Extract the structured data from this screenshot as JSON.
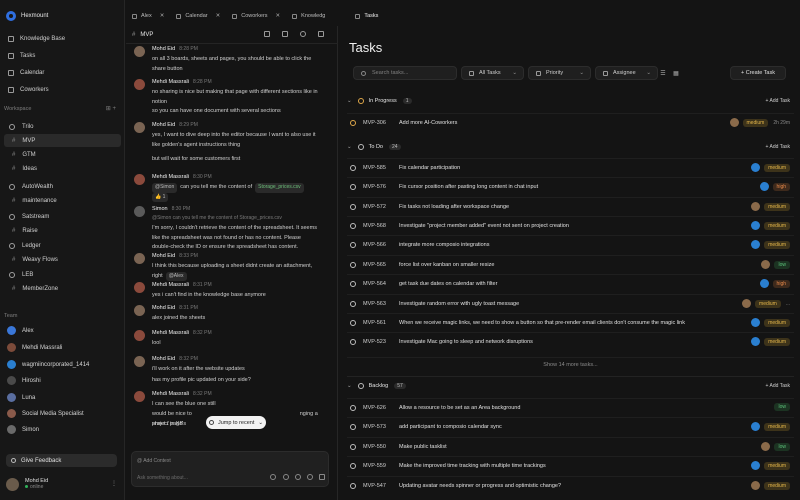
{
  "workspace": {
    "name": "Hexmount"
  },
  "nav": [
    {
      "label": "Knowledge Base",
      "icon": "book-icon"
    },
    {
      "label": "Tasks",
      "icon": "checklist-icon"
    },
    {
      "label": "Calendar",
      "icon": "calendar-icon"
    },
    {
      "label": "Coworkers",
      "icon": "people-icon"
    }
  ],
  "workspace_section": {
    "label": "Workspace"
  },
  "workspace_items": [
    {
      "label": "Trilo",
      "type": "group"
    },
    {
      "label": "MVP",
      "type": "channel",
      "active": true
    },
    {
      "label": "GTM",
      "type": "channel"
    },
    {
      "label": "Ideas",
      "type": "channel"
    },
    {
      "label": "AutoWealth",
      "type": "group"
    },
    {
      "label": "maintenance",
      "type": "channel"
    },
    {
      "label": "Satstream",
      "type": "group"
    },
    {
      "label": "Raise",
      "type": "channel"
    },
    {
      "label": "Ledger",
      "type": "group"
    },
    {
      "label": "Weavy Flows",
      "type": "channel"
    },
    {
      "label": "LEB",
      "type": "group"
    },
    {
      "label": "MemberZone",
      "type": "channel"
    }
  ],
  "team_section": {
    "label": "Team"
  },
  "team": [
    {
      "name": "Alex",
      "color": "#3a77d8"
    },
    {
      "name": "Mehdi Massrali",
      "color": "#7c4b3a"
    },
    {
      "name": "wagmiincorporated_1414",
      "color": "#2a7fd0"
    },
    {
      "name": "Hiroshi",
      "color": "#4a4a4a"
    },
    {
      "name": "Luna",
      "color": "#5a6ea0"
    },
    {
      "name": "Social Media Specialist",
      "color": "#8a5a4a"
    },
    {
      "name": "Simon",
      "color": "#6a6a6a"
    }
  ],
  "feedback": {
    "label": "Give Feedback"
  },
  "user": {
    "name": "Mohd Eid",
    "status": "online"
  },
  "tabs": [
    {
      "label": "Alex",
      "active": false
    },
    {
      "label": "Calendar",
      "active": false
    },
    {
      "label": "Coworkers",
      "active": false
    },
    {
      "label": "Knowledg",
      "active": false
    },
    {
      "label": "Tasks",
      "active": true
    }
  ],
  "chat": {
    "channel": "MVP",
    "messages": [
      {
        "author": "Mohd Eid",
        "time": "8:28 PM",
        "lines": [
          "on all 3 boards, sheets and pages, you should be able to click the",
          "share button"
        ]
      },
      {
        "author": "Mehdi Massrali",
        "time": "8:28 PM",
        "lines": [
          "no sharing is nice but making that page with different sections like in",
          "notion"
        ]
      },
      {
        "author": "",
        "time": "",
        "lines": [
          "so you can have one document with several sections"
        ]
      },
      {
        "author": "Mohd Eid",
        "time": "8:29 PM",
        "lines": [
          "yes, I want to dive deep into the editor because I want to also use it",
          "like golden's agent instructions thing"
        ]
      },
      {
        "author": "",
        "time": "",
        "lines": [
          "but will wait for some customers first"
        ]
      },
      {
        "author": "Mehdi Massrali",
        "time": "8:30 PM",
        "lines": [
          "can you tell me the content of"
        ],
        "chip_user": "@Simon",
        "chip_file": "Storage_prices.csv",
        "reaction": "1"
      },
      {
        "author": "Simon",
        "time": "8:30 PM",
        "lines": [
          "I'm sorry, I couldn't retrieve the content of the spreadsheet. It seems",
          "like the spreadsheet was not found or has no content. Please",
          "double-check the ID or ensure the spreadsheet has content."
        ],
        "reply": "@Simon can you tell me the content of Storage_prices.csv"
      },
      {
        "author": "Mohd Eid",
        "time": "8:33 PM",
        "lines": [
          "I think this because uploading a sheet didnt create an attachment,",
          "right"
        ],
        "chip_user": "@Alex"
      },
      {
        "author": "Mehdi Massrali",
        "time": "8:31 PM",
        "lines": [
          "yes i can't find in the knowledge base anymore"
        ]
      },
      {
        "author": "Mohd Eid",
        "time": "8:31 PM",
        "lines": [
          "alex joined the sheets"
        ]
      },
      {
        "author": "Mehdi Massrali",
        "time": "8:32 PM",
        "lines": [
          "lool"
        ]
      },
      {
        "author": "Mohd Eid",
        "time": "8:32 PM",
        "lines": [
          "i'll work on it after the website updates"
        ]
      },
      {
        "author": "",
        "time": "",
        "lines": [
          "has my profile pic updated on your side?"
        ]
      },
      {
        "author": "Mehdi Massrali",
        "time": "8:32 PM",
        "lines": [
          "I can see the blue one still"
        ]
      },
      {
        "author": "",
        "time": "",
        "lines": [
          "would be nice to",
          "project in KB"
        ],
        "tail": "nging a sheet / page's"
      }
    ],
    "jump_label": "Jump to recent",
    "compose": {
      "context_label": "Add Context",
      "placeholder": "Ask something about..."
    }
  },
  "tasks": {
    "title": "Tasks",
    "search_placeholder": "Search tasks...",
    "filters": [
      {
        "label": "All Tasks",
        "icon": "list-icon"
      },
      {
        "label": "Priority",
        "icon": "flag-icon"
      },
      {
        "label": "Assignee",
        "icon": "user-icon"
      }
    ],
    "create_label": "+  Create Task",
    "groups": [
      {
        "name": "In Progress",
        "count": "1",
        "add_label": "+ Add Task",
        "items": [
          {
            "id": "MVP-306",
            "name": "Add more AI-Coworkers",
            "priority": "medium",
            "avatar": "#8a6a4a",
            "extra": "2h 29m"
          }
        ]
      },
      {
        "name": "To Do",
        "count": "24",
        "add_label": "+ Add Task",
        "items": [
          {
            "id": "MVP-585",
            "name": "Fix calendar participation",
            "priority": "medium",
            "avatar": "#2a7fd0"
          },
          {
            "id": "MVP-576",
            "name": "Fix cursor position after pasting long content in chat input",
            "priority": "high",
            "avatar": "#2a7fd0"
          },
          {
            "id": "MVP-572",
            "name": "Fix tasks not loading after workspace change",
            "priority": "medium",
            "avatar": "#8a6a4a"
          },
          {
            "id": "MVP-568",
            "name": "Investigate \"project member added\" event not sent on project creation",
            "priority": "medium",
            "avatar": "#2a7fd0"
          },
          {
            "id": "MVP-566",
            "name": "integrate more composio integrations",
            "priority": "medium",
            "avatar": "#2a7fd0"
          },
          {
            "id": "MVP-565",
            "name": "force list over kanban on smaller resize",
            "priority": "low",
            "avatar": "#8a6a4a"
          },
          {
            "id": "MVP-564",
            "name": "get task due dates on calendar with filter",
            "priority": "high",
            "avatar": "#2a7fd0"
          },
          {
            "id": "MVP-563",
            "name": "Investigate random error with ugly toast message",
            "priority": "medium",
            "avatar": "#8a6a4a",
            "extra": "..."
          },
          {
            "id": "MVP-561",
            "name": "When we receive magic links, we need to show a button so that pre-render email clients don't consume the magic link",
            "priority": "medium",
            "avatar": "#2a7fd0"
          },
          {
            "id": "MVP-523",
            "name": "Investigate Mac going to sleep and network disruptions",
            "priority": "medium",
            "avatar": "#2a7fd0"
          }
        ],
        "show_more": "Show 14 more tasks..."
      },
      {
        "name": "Backlog",
        "count": "57",
        "add_label": "+ Add Task",
        "items": [
          {
            "id": "MVP-626",
            "name": "Allow a resource to be set as an Area background",
            "priority": "low",
            "avatar": ""
          },
          {
            "id": "MVP-573",
            "name": "add participant to composio calendar sync",
            "priority": "medium",
            "avatar": "#2a7fd0"
          },
          {
            "id": "MVP-550",
            "name": "Make public tasklist",
            "priority": "low",
            "avatar": "#8a6a4a"
          },
          {
            "id": "MVP-559",
            "name": "Make the improved time tracking with multiple time trackings",
            "priority": "medium",
            "avatar": "#2a7fd0"
          },
          {
            "id": "MVP-547",
            "name": "Updating avatar needs spinner or progress and optimistic change?",
            "priority": "medium",
            "avatar": "#8a6a4a"
          }
        ]
      }
    ]
  }
}
